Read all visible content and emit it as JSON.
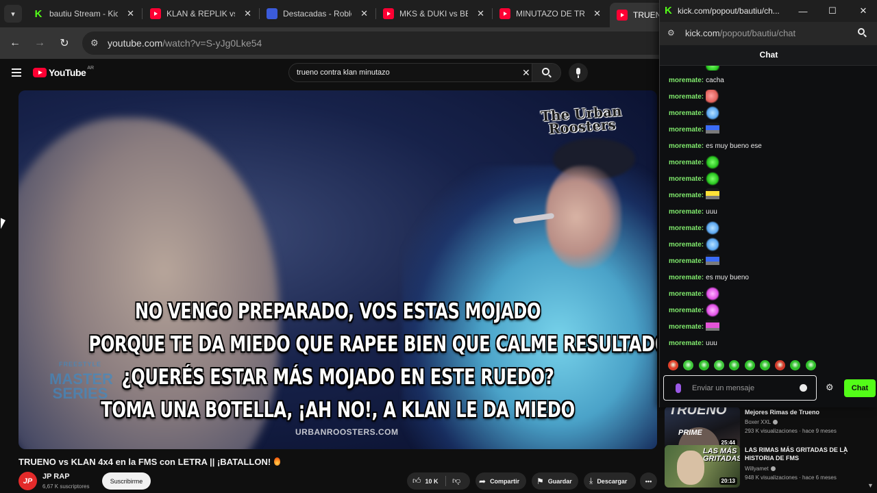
{
  "browser": {
    "tabs": [
      {
        "title": "bautiu Stream - Kick",
        "favicon": "kick-icon"
      },
      {
        "title": "KLAN & REPLIK vs",
        "favicon": "youtube-icon"
      },
      {
        "title": "Destacadas - Roblox",
        "favicon": "roblox-icon"
      },
      {
        "title": "MKS & DUKI vs BE",
        "favicon": "youtube-icon"
      },
      {
        "title": "MINUTAZO DE TRI",
        "favicon": "youtube-icon"
      },
      {
        "title": "TRUENO",
        "favicon": "youtube-icon"
      }
    ],
    "address": {
      "host": "youtube.com",
      "path": "/watch?v=S-yJg0Lke54"
    }
  },
  "youtube": {
    "logo_text": "YouTube",
    "region": "AR",
    "search_query": "trueno contra klan minutazo",
    "video": {
      "subtitles": [
        "NO VENGO PREPARADO, VOS ESTAS MOJADO",
        "PORQUE TE DA MIEDO QUE RAPEE BIEN QUE CALME RESULTADO",
        "¿QUERÉS ESTAR MÁS MOJADO EN ESTE RUEDO?",
        "TOMA UNA BOTELLA, ¡AH NO!, A KLAN LE DA MIEDO"
      ],
      "watermark": "The Urban Roosters",
      "site_watermark": "URBANROOSTERS.COM",
      "fms_logo": {
        "top": "FREESTYLE",
        "main": "MASTER SERIES"
      }
    },
    "title": "TRUENO vs KLAN 4x4 en la FMS con LETRA || ¡BATALLON!",
    "channel": {
      "name": "JP RAP",
      "avatar_text": "JP",
      "subscribers": "6,67 K suscriptores"
    },
    "subscribe_label": "Suscribirme",
    "actions": {
      "likes": "10 K",
      "share": "Compartir",
      "save": "Guardar",
      "download": "Descargar"
    },
    "recommendations": [
      {
        "title": "Mejores Rimas de Trueno",
        "channel": "Boxer XXL",
        "meta": "293 K visualizaciones · hace 9 meses",
        "duration": "25:44",
        "thumb_text": "PRIME",
        "thumb_top": "TRUENO"
      },
      {
        "title": "LAS RIMAS MÁS GRITADAS DE LA HISTORIA DE FMS",
        "channel": "Willyamet",
        "meta": "948 K visualizaciones · hace 6 meses",
        "duration": "20:13",
        "thumb_text": "LAS MÁS GRITADAS"
      }
    ]
  },
  "kick_popout": {
    "window_title": "kick.com/popout/bautiu/ch...",
    "address": {
      "host": "kick.com",
      "path": "/popout/bautiu/chat"
    },
    "chat_title": "Chat",
    "messages": [
      {
        "user": "moremate:",
        "text": "",
        "emote": "em-top"
      },
      {
        "user": "moremate:",
        "text": "cacha",
        "emote": ""
      },
      {
        "user": "moremate:",
        "text": "",
        "emote": "em-hand"
      },
      {
        "user": "moremate:",
        "text": "",
        "emote": "em-wing"
      },
      {
        "user": "moremate:",
        "text": "",
        "emote": "em-car"
      },
      {
        "user": "moremate:",
        "text": "es muy bueno ese",
        "emote": ""
      },
      {
        "user": "moremate:",
        "text": "",
        "emote": "em-leaf"
      },
      {
        "user": "moremate:",
        "text": "",
        "emote": "em-leaf"
      },
      {
        "user": "moremate:",
        "text": "",
        "emote": "em-car2"
      },
      {
        "user": "moremate:",
        "text": "uuu",
        "emote": ""
      },
      {
        "user": "moremate:",
        "text": "",
        "emote": "em-wing"
      },
      {
        "user": "moremate:",
        "text": "",
        "emote": "em-wing"
      },
      {
        "user": "moremate:",
        "text": "",
        "emote": "em-car"
      },
      {
        "user": "moremate:",
        "text": "es muy bueno",
        "emote": ""
      },
      {
        "user": "moremate:",
        "text": "",
        "emote": "em-pwing"
      },
      {
        "user": "moremate:",
        "text": "",
        "emote": "em-pwing"
      },
      {
        "user": "moremate:",
        "text": "",
        "emote": "em-pink"
      },
      {
        "user": "moremate:",
        "text": "uuu",
        "emote": ""
      }
    ],
    "quick_emotes": [
      "#e0402a",
      "#3ec63a",
      "#2fbf2a",
      "#3ec63a",
      "#2fbf2a",
      "#2fbf2a",
      "#2fbf2a",
      "#d23a2a",
      "#2fbf2a",
      "#2fbf2a"
    ],
    "input_placeholder": "Enviar un mensaje",
    "send_label": "Chat",
    "accent": "#53fc18"
  }
}
